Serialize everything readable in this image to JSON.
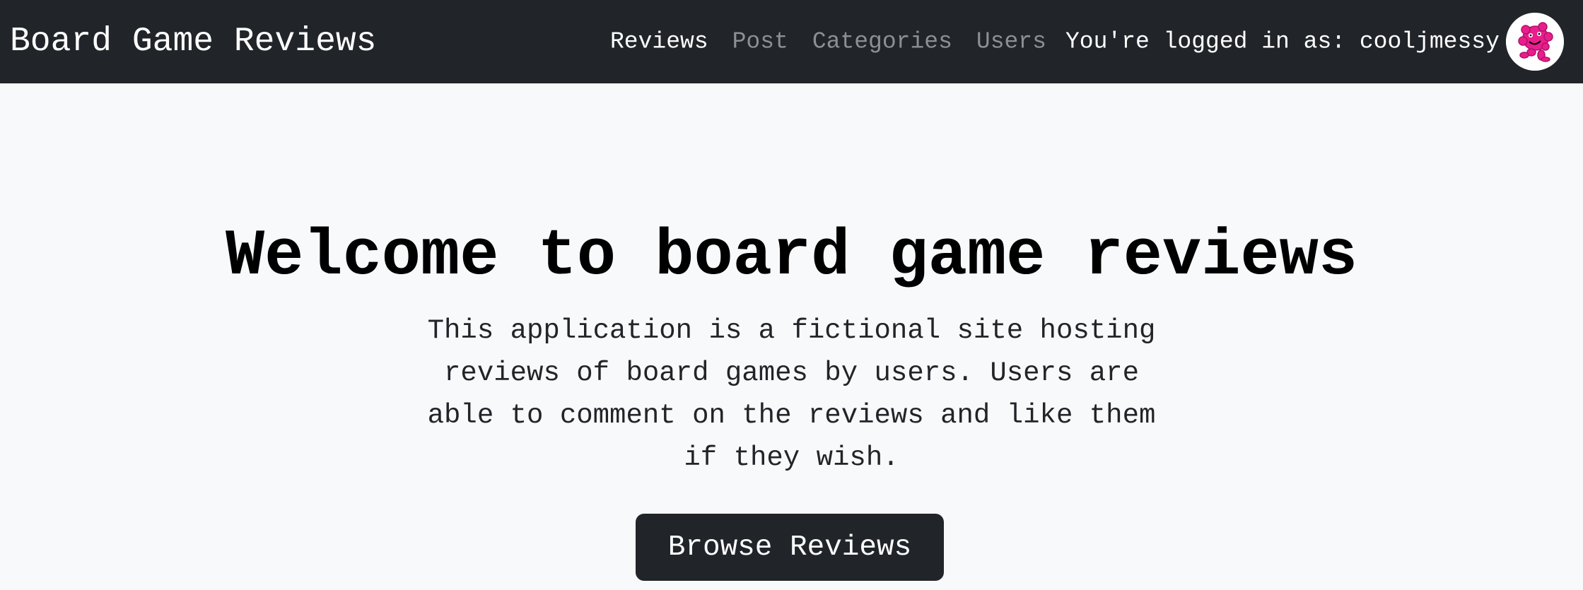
{
  "navbar": {
    "brand": "Board Game Reviews",
    "links": [
      {
        "label": "Reviews",
        "active": true
      },
      {
        "label": "Post",
        "active": false
      },
      {
        "label": "Categories",
        "active": false
      },
      {
        "label": "Users",
        "active": false
      }
    ],
    "logged_in_text": "You're logged in as: cooljmessy",
    "avatar_icon": "user-avatar-pink-monster-icon"
  },
  "hero": {
    "title": "Welcome to board game reviews",
    "description": "This application is a fictional site hosting reviews of board games by users. Users are able to comment on the reviews and like them if they wish.",
    "button_label": "Browse Reviews"
  },
  "colors": {
    "navbar_bg": "#212529",
    "page_bg": "#f8f9fa",
    "nav_inactive": "#8c8f93",
    "avatar_accent": "#e91e8c"
  }
}
